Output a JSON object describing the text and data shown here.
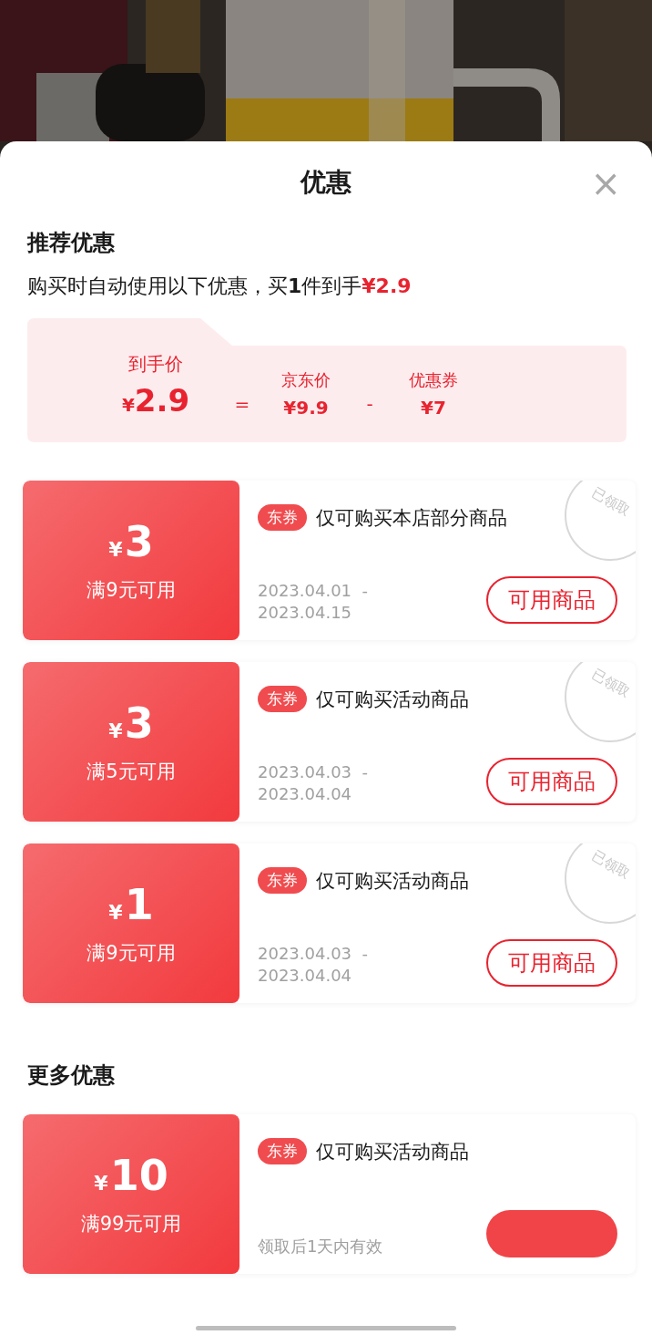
{
  "sheet": {
    "title": "优惠",
    "close": "×"
  },
  "recommended": {
    "title": "推荐优惠",
    "summary": "购买时自动使用以下优惠，买**1**件到手",
    "summary_price": "¥2.9",
    "breakdown": [
      {
        "kind": "total",
        "label": "到手价",
        "currency": "¥",
        "value": "2.9"
      },
      {
        "kind": "operator",
        "value": "="
      },
      {
        "kind": "term",
        "label": "京东价",
        "value": "¥9.9"
      },
      {
        "kind": "operator",
        "value": "-"
      },
      {
        "kind": "term",
        "label": "优惠券",
        "value": "¥7"
      }
    ],
    "coupons": [
      {
        "currency": "¥",
        "amount": "3",
        "condition": "满9元可用",
        "tag": "东券",
        "scope": "仅可购买本店部分商品",
        "validity": [
          "2023.04.01  -",
          "2023.04.15"
        ],
        "claimed": true,
        "stamp": "已领取",
        "action": {
          "kind": "outline",
          "label": "可用商品"
        }
      },
      {
        "currency": "¥",
        "amount": "3",
        "condition": "满5元可用",
        "tag": "东券",
        "scope": "仅可购买活动商品",
        "validity": [
          "2023.04.03  -",
          "2023.04.04"
        ],
        "claimed": true,
        "stamp": "已领取",
        "action": {
          "kind": "outline",
          "label": "可用商品"
        }
      },
      {
        "currency": "¥",
        "amount": "1",
        "condition": "满9元可用",
        "tag": "东券",
        "scope": "仅可购买活动商品",
        "validity": [
          "2023.04.03  -",
          "2023.04.04"
        ],
        "claimed": true,
        "stamp": "已领取",
        "action": {
          "kind": "outline",
          "label": "可用商品"
        }
      }
    ]
  },
  "more": {
    "title": "更多优惠",
    "coupons": [
      {
        "currency": "¥",
        "amount": "10",
        "condition": "满99元可用",
        "tag": "东券",
        "scope": "仅可购买活动商品",
        "validity": [
          "领取后1天内有效"
        ],
        "claimed": false,
        "action": {
          "kind": "filled"
        }
      }
    ]
  }
}
